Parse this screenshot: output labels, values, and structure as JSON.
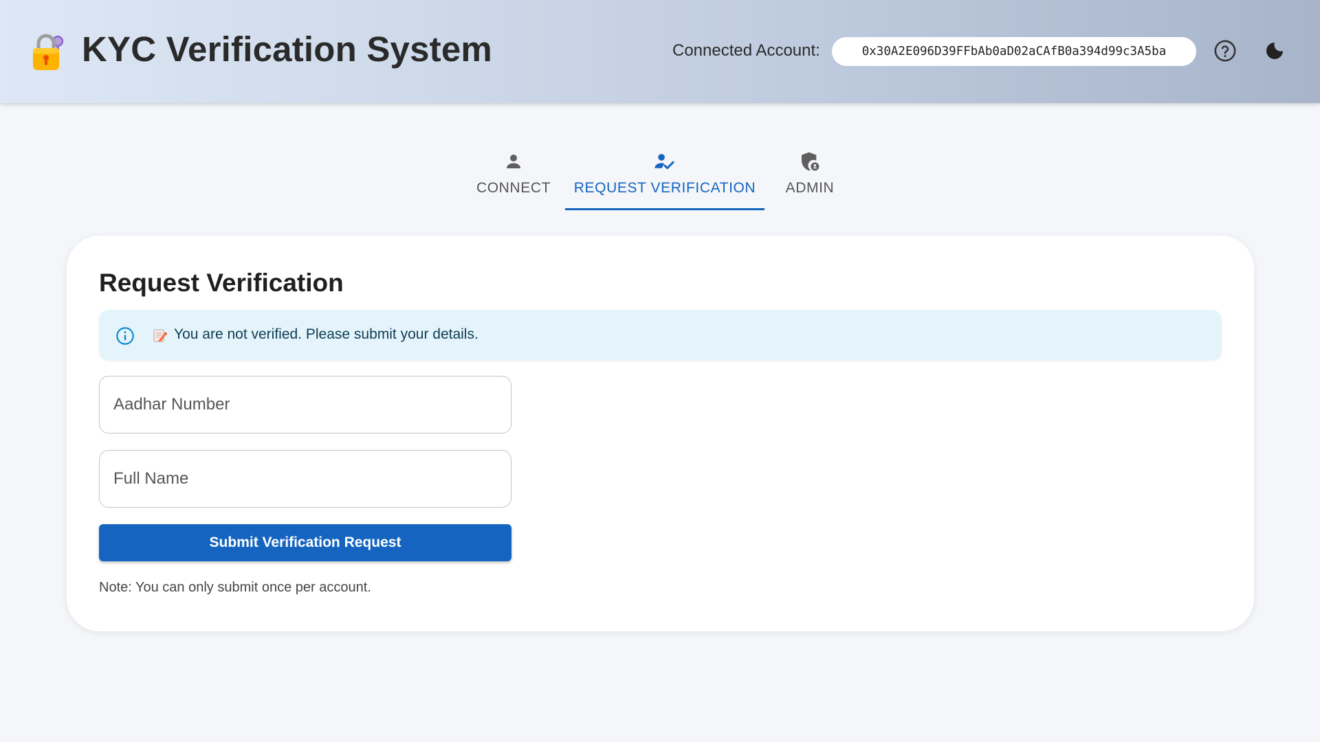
{
  "header": {
    "title": "KYC Verification System",
    "logo_icon": "lock-with-key-icon",
    "account_label": "Connected Account:",
    "account_address": "0x30A2E096D39FFbAb0aD02aCAfB0a394d99c3A5ba",
    "help_icon": "help-circle-icon",
    "theme_icon": "dark-mode-moon-icon"
  },
  "tabs": [
    {
      "label": "CONNECT",
      "icon": "person-icon",
      "active": false
    },
    {
      "label": "REQUEST VERIFICATION",
      "icon": "person-check-icon",
      "active": true
    },
    {
      "label": "ADMIN",
      "icon": "admin-shield-icon",
      "active": false
    }
  ],
  "card": {
    "title": "Request Verification",
    "alert": {
      "icon": "info-icon",
      "emoji": "memo-icon",
      "text": "You are not verified. Please submit your details."
    },
    "aadhar_placeholder": "Aadhar Number",
    "aadhar_value": "",
    "name_placeholder": "Full Name",
    "name_value": "",
    "submit_label": "Submit Verification Request",
    "note": "Note: You can only submit once per account."
  },
  "colors": {
    "primary": "#1565c0",
    "alert_bg": "#e5f4fb",
    "alert_icon": "#0288d1",
    "background": "#f4f6f9"
  }
}
